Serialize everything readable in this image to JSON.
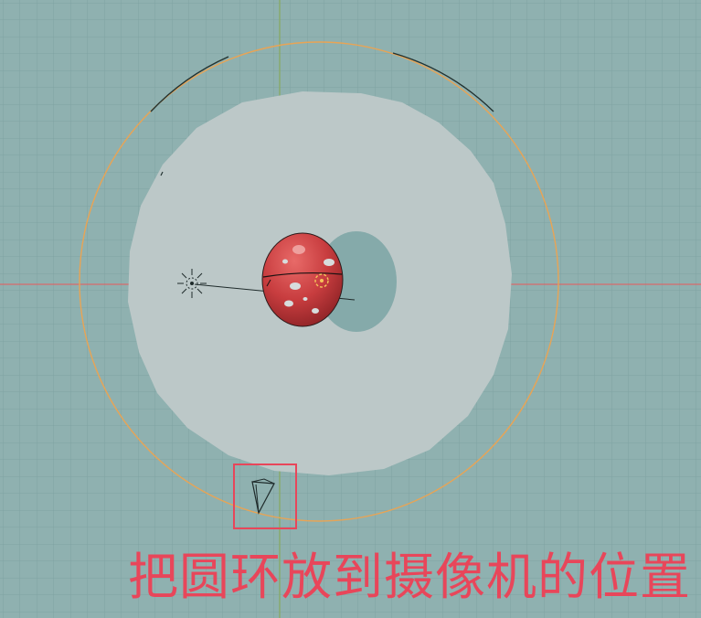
{
  "viewport": {
    "background_color": "#8fb1b0",
    "grid_color": "#7fa3a2",
    "x_axis_color": "#d66b6b",
    "y_axis_color": "#88a85e"
  },
  "scene": {
    "ground_disc_color": "#bcc8c8",
    "shadow_color": "#85aaaa",
    "path_circle_color": "#e8a455",
    "path_circle_selected_arc_color": "#223230",
    "sphere_color": "#c83d3f",
    "light_icon": "sun-lamp-icon",
    "camera_icon": "camera-icon",
    "highlight_box_color": "#e8465a"
  },
  "annotation": {
    "caption": "把圆环放到摄像机的位置",
    "caption_color": "#e8465a"
  }
}
